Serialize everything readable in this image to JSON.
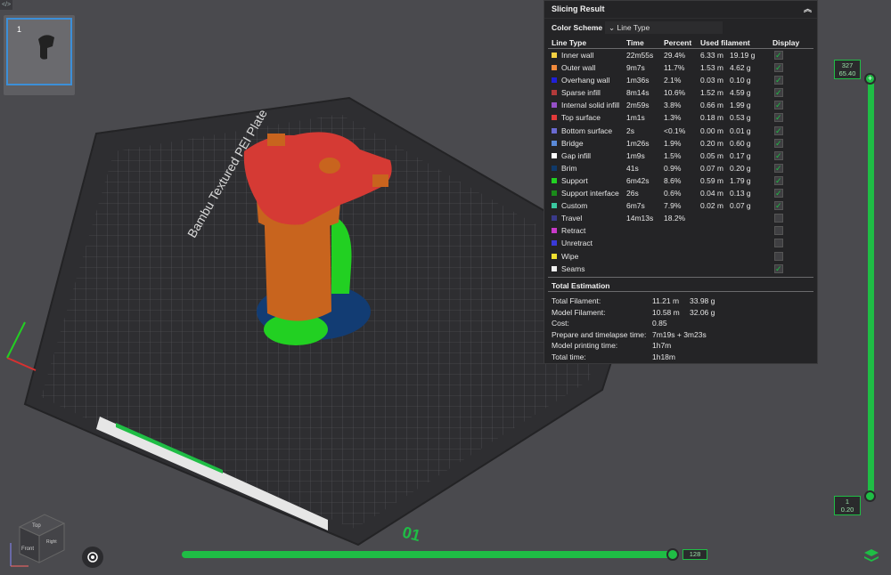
{
  "plate": {
    "number": "1"
  },
  "bed": {
    "plate_name": "Bambu Textured PEI Plate",
    "plate_number": "01"
  },
  "panel": {
    "title": "Slicing Result",
    "color_scheme_label": "Color Scheme",
    "color_scheme_value": "Line Type",
    "headers": {
      "line_type": "Line Type",
      "time": "Time",
      "percent": "Percent",
      "used": "Used filament",
      "display": "Display"
    },
    "rows": [
      {
        "name": "Inner wall",
        "color": "#f5d142",
        "time": "22m55s",
        "percent": "29.4%",
        "len": "6.33 m",
        "weight": "19.19 g",
        "display": true
      },
      {
        "name": "Outer wall",
        "color": "#f08a3c",
        "time": "9m7s",
        "percent": "11.7%",
        "len": "1.53 m",
        "weight": "4.62 g",
        "display": true
      },
      {
        "name": "Overhang wall",
        "color": "#2020d8",
        "time": "1m36s",
        "percent": "2.1%",
        "len": "0.03 m",
        "weight": "0.10 g",
        "display": true
      },
      {
        "name": "Sparse infill",
        "color": "#b23a3a",
        "time": "8m14s",
        "percent": "10.6%",
        "len": "1.52 m",
        "weight": "4.59 g",
        "display": true
      },
      {
        "name": "Internal solid infill",
        "color": "#9650c8",
        "time": "2m59s",
        "percent": "3.8%",
        "len": "0.66 m",
        "weight": "1.99 g",
        "display": true
      },
      {
        "name": "Top surface",
        "color": "#e23a3a",
        "time": "1m1s",
        "percent": "1.3%",
        "len": "0.18 m",
        "weight": "0.53 g",
        "display": true
      },
      {
        "name": "Bottom surface",
        "color": "#6a6ad0",
        "time": "2s",
        "percent": "<0.1%",
        "len": "0.00 m",
        "weight": "0.01 g",
        "display": true
      },
      {
        "name": "Bridge",
        "color": "#5a8ad8",
        "time": "1m26s",
        "percent": "1.9%",
        "len": "0.20 m",
        "weight": "0.60 g",
        "display": true
      },
      {
        "name": "Gap infill",
        "color": "#ffffff",
        "time": "1m9s",
        "percent": "1.5%",
        "len": "0.05 m",
        "weight": "0.17 g",
        "display": true
      },
      {
        "name": "Brim",
        "color": "#103a6a",
        "time": "41s",
        "percent": "0.9%",
        "len": "0.07 m",
        "weight": "0.20 g",
        "display": true
      },
      {
        "name": "Support",
        "color": "#22d022",
        "time": "6m42s",
        "percent": "8.6%",
        "len": "0.59 m",
        "weight": "1.79 g",
        "display": true
      },
      {
        "name": "Support interface",
        "color": "#1a8a1a",
        "time": "26s",
        "percent": "0.6%",
        "len": "0.04 m",
        "weight": "0.13 g",
        "display": true
      },
      {
        "name": "Custom",
        "color": "#3ac8a0",
        "time": "6m7s",
        "percent": "7.9%",
        "len": "0.02 m",
        "weight": "0.07 g",
        "display": true
      },
      {
        "name": "Travel",
        "color": "#3a3a8a",
        "time": "14m13s",
        "percent": "18.2%",
        "len": "",
        "weight": "",
        "display": false
      },
      {
        "name": "Retract",
        "color": "#c83ac8",
        "time": "",
        "percent": "",
        "len": "",
        "weight": "",
        "display": false
      },
      {
        "name": "Unretract",
        "color": "#3a3ad8",
        "time": "",
        "percent": "",
        "len": "",
        "weight": "",
        "display": false
      },
      {
        "name": "Wipe",
        "color": "#f0e030",
        "time": "",
        "percent": "",
        "len": "",
        "weight": "",
        "display": false
      },
      {
        "name": "Seams",
        "color": "#f0f0f0",
        "time": "",
        "percent": "",
        "len": "",
        "weight": "",
        "display": true
      }
    ],
    "estimation_title": "Total Estimation",
    "estimation": [
      {
        "label": "Total Filament:",
        "value": "11.21 m",
        "value2": "33.98 g"
      },
      {
        "label": "Model Filament:",
        "value": "10.58 m",
        "value2": "32.06 g"
      },
      {
        "label": "Cost:",
        "value": "0.85",
        "value2": ""
      },
      {
        "label": "Prepare and timelapse time:",
        "value": "7m19s + 3m23s",
        "value2": ""
      },
      {
        "label": "Model printing time:",
        "value": "1h7m",
        "value2": ""
      },
      {
        "label": "Total time:",
        "value": "1h18m",
        "value2": ""
      }
    ]
  },
  "layer_slider": {
    "top_layer": "327",
    "top_height": "65.40",
    "bottom_layer": "1",
    "bottom_height": "0.20"
  },
  "move_slider": {
    "value": "128"
  },
  "view_cube": {
    "top": "Top",
    "front": "Front",
    "right": "Right"
  }
}
